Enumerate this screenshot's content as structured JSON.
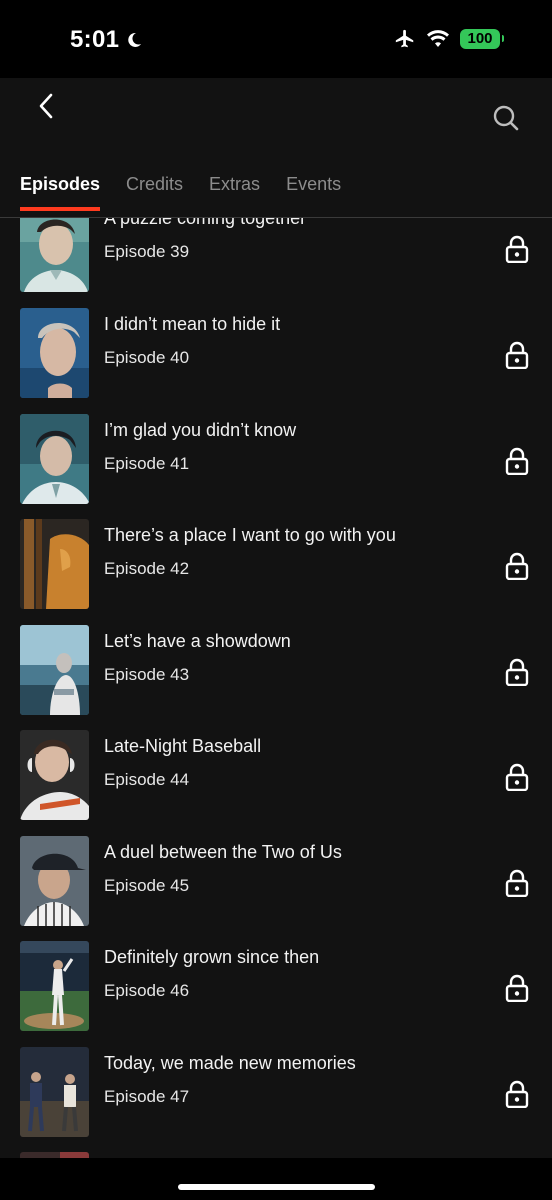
{
  "status_bar": {
    "time": "5:01",
    "battery": "100",
    "icons": [
      "moon-icon",
      "airplane-icon",
      "wifi-icon",
      "battery-icon"
    ]
  },
  "header": {
    "back_icon": "chevron-left-icon",
    "search_icon": "search-icon"
  },
  "tabs": [
    {
      "label": "Episodes",
      "active": true
    },
    {
      "label": "Credits",
      "active": false
    },
    {
      "label": "Extras",
      "active": false
    },
    {
      "label": "Events",
      "active": false
    }
  ],
  "episodes": [
    {
      "title": "A puzzle coming together",
      "number": "Episode 39",
      "locked": true
    },
    {
      "title": "I didn’t mean to hide it",
      "number": "Episode 40",
      "locked": true
    },
    {
      "title": "I’m glad you didn’t know",
      "number": "Episode 41",
      "locked": true
    },
    {
      "title": "There’s a place I want to go with you",
      "number": "Episode 42",
      "locked": true
    },
    {
      "title": "Let’s have a showdown",
      "number": "Episode 43",
      "locked": true
    },
    {
      "title": "Late-Night Baseball",
      "number": "Episode 44",
      "locked": true
    },
    {
      "title": "A duel between the Two of Us",
      "number": "Episode 45",
      "locked": true
    },
    {
      "title": "Definitely grown since then",
      "number": "Episode 46",
      "locked": true
    },
    {
      "title": "Today, we made new memories",
      "number": "Episode 47",
      "locked": true
    }
  ],
  "colors": {
    "accent": "#ff3b1f",
    "battery": "#34c759",
    "background": "#121212"
  }
}
